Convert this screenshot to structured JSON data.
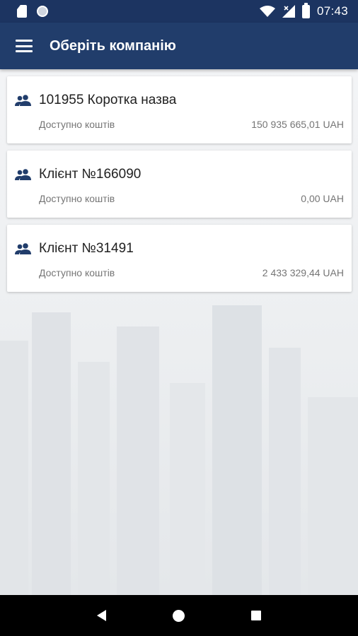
{
  "status_bar": {
    "time": "07:43",
    "icons": [
      "sd-card-icon",
      "notification-circle-icon",
      "wifi-icon",
      "signal-icon",
      "battery-icon"
    ]
  },
  "app_bar": {
    "title": "Оберіть компанію",
    "menu_icon": "menu-icon"
  },
  "companies": [
    {
      "name": "101955 Коротка назва",
      "label": "Доступно коштів",
      "amount": "150 935 665,01 UAH"
    },
    {
      "name": "Клієнт №166090",
      "label": "Доступно коштів",
      "amount": "0,00 UAH"
    },
    {
      "name": "Клієнт №31491",
      "label": "Доступно коштів",
      "amount": "2 433 329,44 UAH"
    }
  ],
  "nav_bar": {
    "icons": [
      "back-icon",
      "home-icon",
      "recent-apps-icon"
    ]
  },
  "colors": {
    "status_bar": "#1c3461",
    "app_bar": "#213d6b",
    "card_background": "#ffffff",
    "icon": "#213d6b"
  }
}
